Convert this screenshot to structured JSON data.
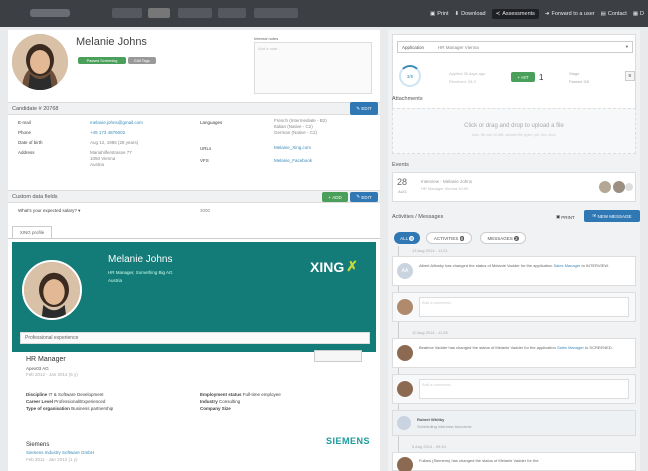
{
  "topbar": {
    "print": "Print",
    "download": "Download",
    "assessments": "Assessments",
    "forward": "Forward to a user",
    "contact": "Contact",
    "more": "D"
  },
  "candidate": {
    "name": "Melanie Johns",
    "status_badge": "Passed Screening",
    "edit_tags": "Edit Tags",
    "internal_notes_label": "Internal notes",
    "internal_notes_sub": "Add a note...",
    "id_label": "Candidate # 20768",
    "edit": "EDIT"
  },
  "details": {
    "email_label": "E-mail",
    "email_value": "melanie.johns@gmail.com",
    "phone_label": "Phone",
    "phone_value": "+49 173 4876002",
    "dob_label": "Date of birth",
    "dob_value": "Aug 12, 1985 (28 years)",
    "address_label": "Address",
    "address_line1": "Mariahilferstrasse 77",
    "address_line2": "1060 Vienna",
    "address_line3": "Austria",
    "languages_label": "Languages",
    "lang1": "French (Intermediate - B2)",
    "lang2": "Italian (Native - C2)",
    "lang3": "German (Native - C2)",
    "urls_label": "URLs",
    "url_value": "Melanie_Xing.com",
    "vfs_label": "VFS",
    "vfs_value": "Melanie_Facebook"
  },
  "custom": {
    "title": "Custom data fields",
    "add": "ADD",
    "edit": "EDIT",
    "question": "What's your expected salary?",
    "answer": "3000"
  },
  "profile_tab": "XING profile",
  "xing": {
    "name": "Melanie Johns",
    "role": "HR Manager, Something Big AG",
    "location": "Austria",
    "logo": "XING",
    "section": "Professional experience",
    "job_title": "HR Manager",
    "company": "Apex03 AG",
    "period": "Feb 2012 - Jan 2014 (6 y)",
    "discipline_label": "Discipline",
    "discipline": "IT & Software Development",
    "career_label": "Career Level",
    "career": "Professional/Experienced",
    "org_label": "Type of organisation",
    "org": "Business partnership",
    "employment_label": "Employment status",
    "employment": "Full-time employee",
    "industry_label": "Industry",
    "industry": "Consulting",
    "size_label": "Company Size",
    "size": "",
    "next_title": "Siemens",
    "next_sub": "Siemens Industry Software GmbH",
    "next_period": "Feb 2011 - Jan 2012 (1 y)",
    "siemens_logo": "SIEMENS"
  },
  "right": {
    "application_label": "Application",
    "application_value": "HR Manager Vienna",
    "rating_score": "3/5",
    "days": "Applied 36 days ago",
    "date": "Received: 28.3",
    "hire": "HIT",
    "hire_count": "1",
    "stage_label": "Stage",
    "stage_value": "Passed 3/5",
    "attachments_title": "Attachments",
    "drop_text": "Click or drag and drop to upload a file",
    "drop_sub": "Max. file size 10 MB, allowed file types: pdf, doc, docx",
    "events_title": "Events",
    "event_day": "28",
    "event_month": "AUG",
    "event_text": "Interview - Melanie Johns",
    "event_sub": "HR Manager Vienna 10:00",
    "activities_title": "Activities / Messages",
    "print": "PRINT",
    "new_message": "NEW MESSAGE",
    "tab_all": "ALL",
    "tab_all_count": "9",
    "tab_activities": "ACTIVITIES",
    "tab_activities_count": "6",
    "tab_messages": "MESSAGES",
    "tab_messages_count": "3",
    "day1": "13 Aug 2014 - 11:21",
    "act1": "Albert Allinsky has changed the status of Melanie Vadder for the application",
    "act1_link": "Sales Manager",
    "act1_tail": "to INTERVIEW.",
    "comment_placeholder": "Add a comment...",
    "day2": "10 Aug 2014 - 11:26",
    "act2": "Beatrice Vadder has changed the status of Melanie Vadder for the application",
    "act2_link": "Sales Manager",
    "act2_tail": "to SCREENED.",
    "reply_name": "Robert Whitby",
    "reply_text": "Scheduling interview tomorrow",
    "day3": "5 Aug 2014 - 09:44",
    "act3": "Fullars (Siemens) has changed the status of Melanie Vadder for the"
  }
}
